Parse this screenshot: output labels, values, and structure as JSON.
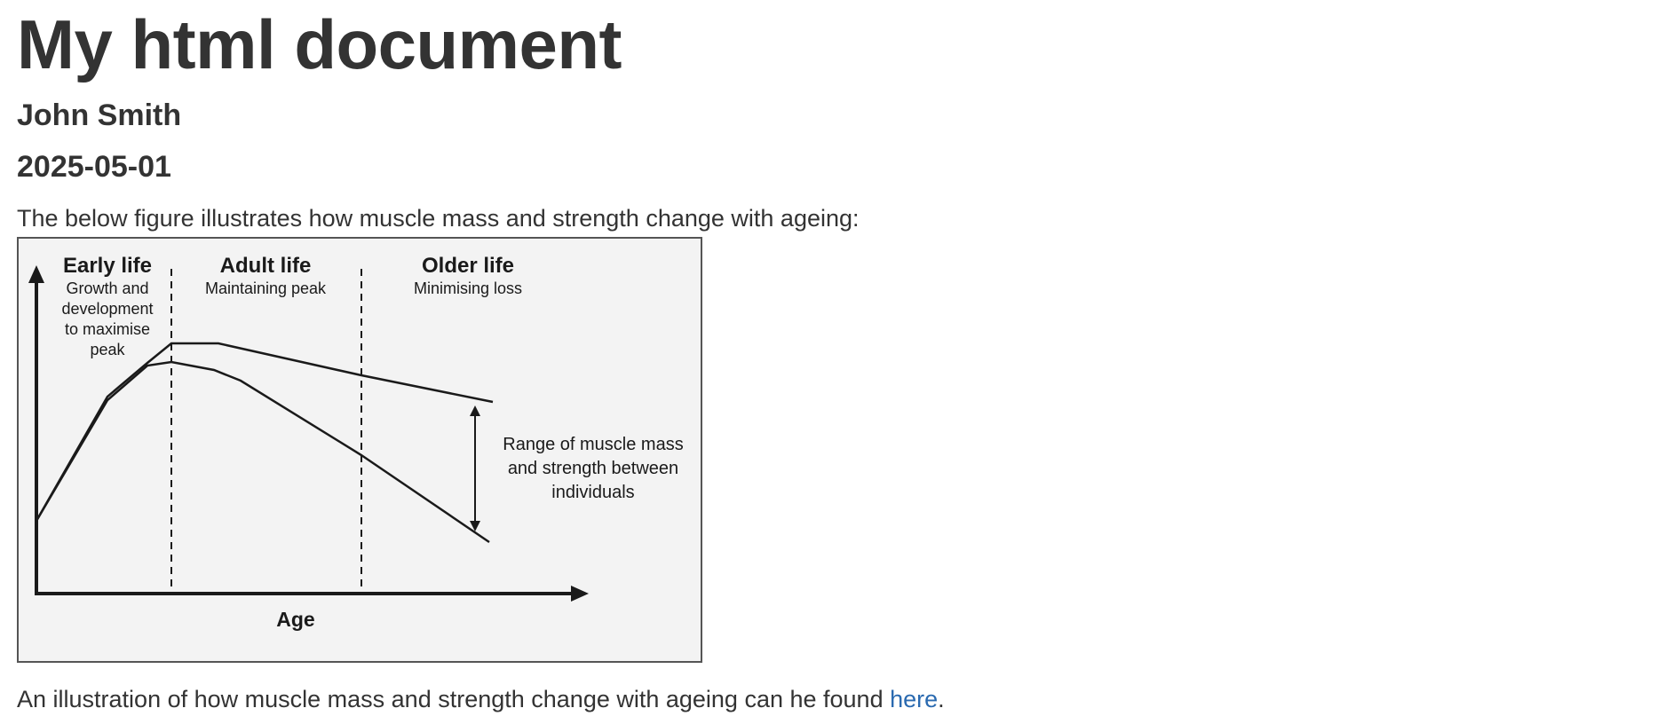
{
  "document": {
    "title": "My html document",
    "author": "John Smith",
    "date": "2025-05-01",
    "intro": "The below figure illustrates how muscle mass and strength change with ageing:",
    "outro_before_link": "An illustration of how muscle mass and strength change with ageing can he found ",
    "link_text": "here",
    "outro_after_link": "."
  },
  "figure": {
    "phases": [
      {
        "title": "Early life",
        "subtitle_lines": [
          "Growth and",
          "development",
          "to maximise",
          "peak"
        ]
      },
      {
        "title": "Adult life",
        "subtitle_lines": [
          "Maintaining peak"
        ]
      },
      {
        "title": "Older life",
        "subtitle_lines": [
          "Minimising loss"
        ]
      }
    ],
    "range_label_lines": [
      "Range of muscle mass",
      "and strength between",
      "individuals"
    ],
    "x_axis_label": "Age"
  },
  "colors": {
    "text": "#333333",
    "link": "#2a6ab0",
    "figure_background": "#f3f3f3",
    "figure_ink": "#1a1a1a"
  }
}
